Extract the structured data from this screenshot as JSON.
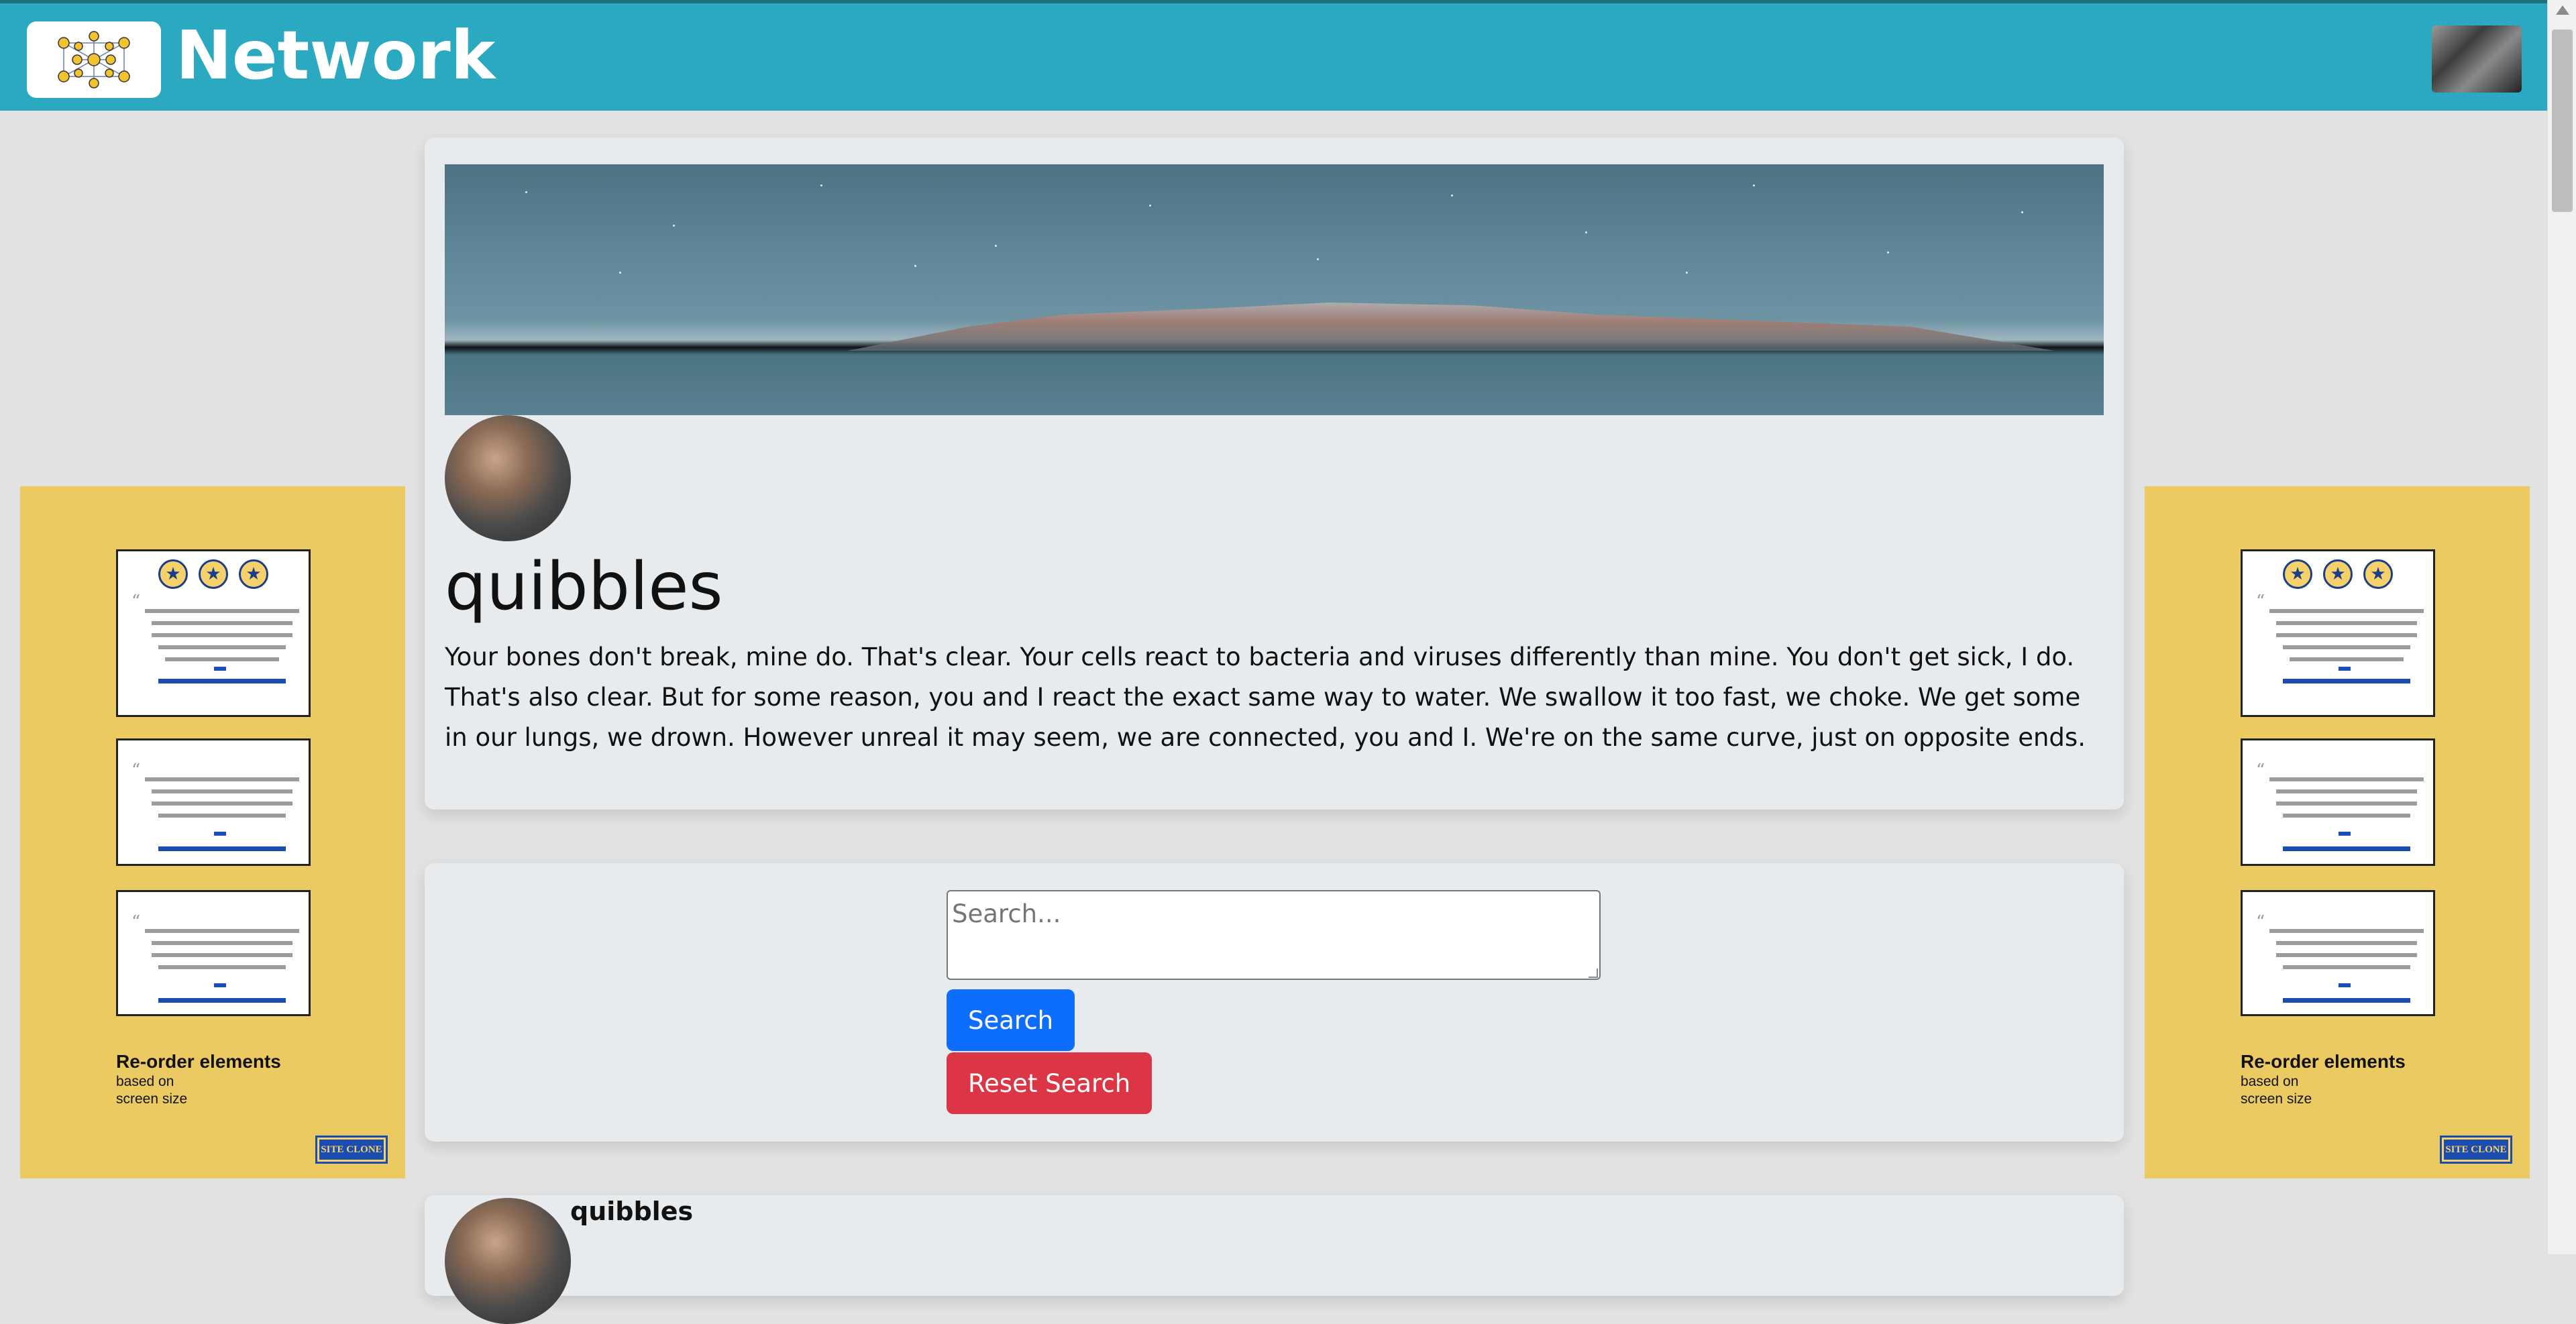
{
  "app": {
    "brand": "Network"
  },
  "icons": {
    "logo": "network-logo-icon",
    "user_avatar": "user-avatar-icon"
  },
  "profile": {
    "username": "quibbles",
    "bio": "Your bones don't break, mine do. That's clear. Your cells react to bacteria and viruses differently than mine. You don't get sick, I do. That's also clear. But for some reason, you and I react the exact same way to water. We swallow it too fast, we choke. We get some in our lungs, we drown. However unreal it may seem, we are connected, you and I. We're on the same curve, just on opposite ends."
  },
  "search": {
    "placeholder": "Search...",
    "search_label": "Search",
    "reset_label": "Reset Search"
  },
  "ads": {
    "title": "Re-order elements",
    "sub1": "based on",
    "sub2": "screen size",
    "badge": "SITE CLONE"
  },
  "posts": [
    {
      "username": "quibbles"
    }
  ],
  "colors": {
    "topbar": "#2aa9c1",
    "ad_background": "#ecca62",
    "search_button": "#0d6efd",
    "reset_button": "#dc3545"
  }
}
